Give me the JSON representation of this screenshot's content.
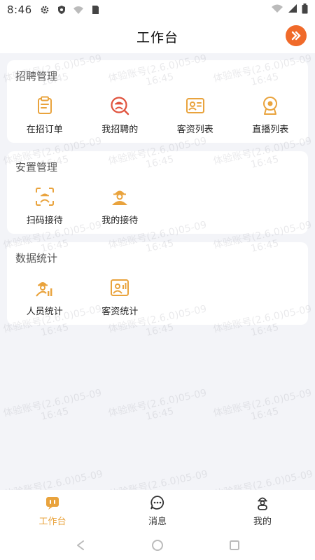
{
  "status_bar": {
    "time": "8:46"
  },
  "header": {
    "title": "工作台"
  },
  "sections": {
    "recruit": {
      "title": "招聘管理",
      "items": [
        {
          "label": "在招订单",
          "icon": "clipboard-icon"
        },
        {
          "label": "我招聘的",
          "icon": "search-person-icon"
        },
        {
          "label": "客资列表",
          "icon": "contact-card-icon"
        },
        {
          "label": "直播列表",
          "icon": "webcam-icon"
        }
      ]
    },
    "placement": {
      "title": "安置管理",
      "items": [
        {
          "label": "扫码接待",
          "icon": "scan-person-icon"
        },
        {
          "label": "我的接待",
          "icon": "worker-icon"
        }
      ]
    },
    "stats": {
      "title": "数据统计",
      "items": [
        {
          "label": "人员统计",
          "icon": "worker-chart-icon"
        },
        {
          "label": "客资统计",
          "icon": "profile-chart-icon"
        }
      ]
    }
  },
  "watermark": {
    "line1": "体验账号(2.6.0)05-09",
    "line2": "16:45"
  },
  "tabbar": {
    "tabs": [
      {
        "label": "工作台",
        "active": true
      },
      {
        "label": "消息",
        "active": false
      },
      {
        "label": "我的",
        "active": false
      }
    ]
  },
  "colors": {
    "accent": "#e9a33d",
    "avatar": "#f06a2a",
    "search_icon": "#e0533e"
  }
}
